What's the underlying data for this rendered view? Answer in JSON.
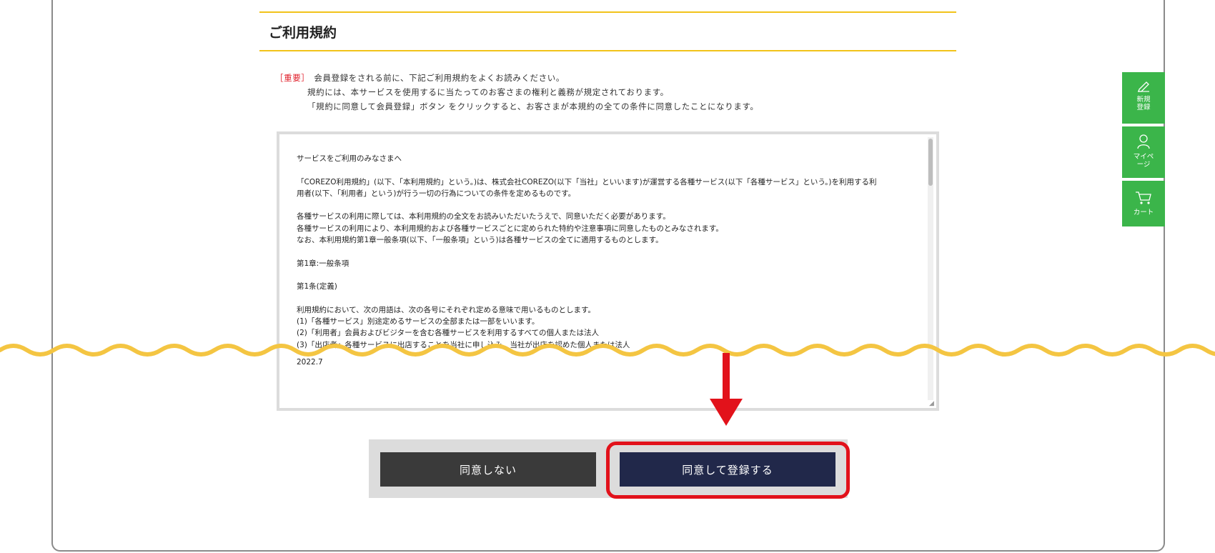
{
  "page": {
    "title": "ご利用規約"
  },
  "notice": {
    "tag": "［重要］",
    "line1": "会員登録をされる前に、下記ご利用規約をよくお読みください。",
    "line2": "規約には、本サービスを使用するに当たってのお客さまの権利と義務が規定されております。",
    "line3": "「規約に同意して会員登録」ボタン をクリックすると、お客さまが本規約の全ての条件に同意したことになります。"
  },
  "terms": {
    "lines": [
      "サービスをご利用のみなさまへ",
      "",
      "「COREZO利用規約」(以下、「本利用規約」という。)は、株式会社COREZO(以下「当社」といいます)が運営する各種サービス(以下「各種サービス」という。)を利用する利",
      "用者(以下、「利用者」という)が行う一切の行為についての条件を定めるものです。",
      "",
      "各種サービスの利用に際しては、本利用規約の全文をお読みいただいたうえで、同意いただく必要があります。",
      "各種サービスの利用により、本利用規約および各種サービスごとに定められた特約や注意事項に同意したものとみなされます。",
      "なお、本利用規約第1章一般条項(以下、「一般条項」という)は各種サービスの全てに適用するものとします。",
      "",
      "第1章:一般条項",
      "",
      "第1条(定義)",
      "",
      "利用規約において、次の用語は、次の各号にそれぞれ定める意味で用いるものとします。",
      "(1)「各種サービス」別途定めるサービスの全部または一部をいいます。",
      "(2)「利用者」会員およびビジターを含む各種サービスを利用するすべての個人または法人",
      "(3)「出店者」各種サービスに出店することを当社に申し込み、当社が出店を認めた個人または法人"
    ],
    "end_date": "2022.7"
  },
  "buttons": {
    "decline_label": "同意しない",
    "agree_label": "同意して登録する"
  },
  "side_nav": {
    "register_label_1": "新規",
    "register_label_2": "登録",
    "mypage_label_1": "マイペ",
    "mypage_label_2": "ージ",
    "cart_label": "カート"
  },
  "colors": {
    "accent_yellow": "#f2c31a",
    "highlight_red": "#e2121b",
    "agree_navy": "#21284a",
    "decline_gray": "#3a3a3a",
    "side_green": "#3bb54a"
  }
}
